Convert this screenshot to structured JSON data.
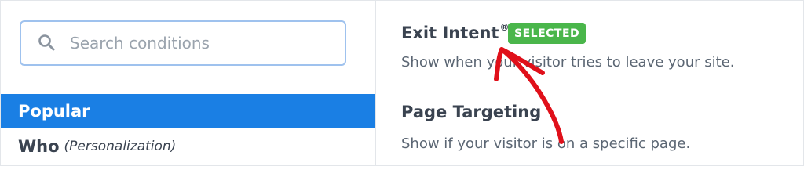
{
  "search": {
    "placeholder": "Search conditions",
    "value": ""
  },
  "categories": [
    {
      "label": "Popular",
      "selected": true
    },
    {
      "label": "Who",
      "sub": "(Personalization)",
      "selected": false
    }
  ],
  "conditions": [
    {
      "title": "Exit Intent",
      "mark": "®",
      "badge": "SELECTED",
      "description": "Show when your visitor tries to leave your site."
    },
    {
      "title": "Page Targeting",
      "description": "Show if your visitor is on a specific page."
    }
  ],
  "colors": {
    "accent": "#1a7fe4",
    "badge": "#4ab64b",
    "annotation": "#e0101a"
  },
  "icons": {
    "search": "search-icon"
  }
}
